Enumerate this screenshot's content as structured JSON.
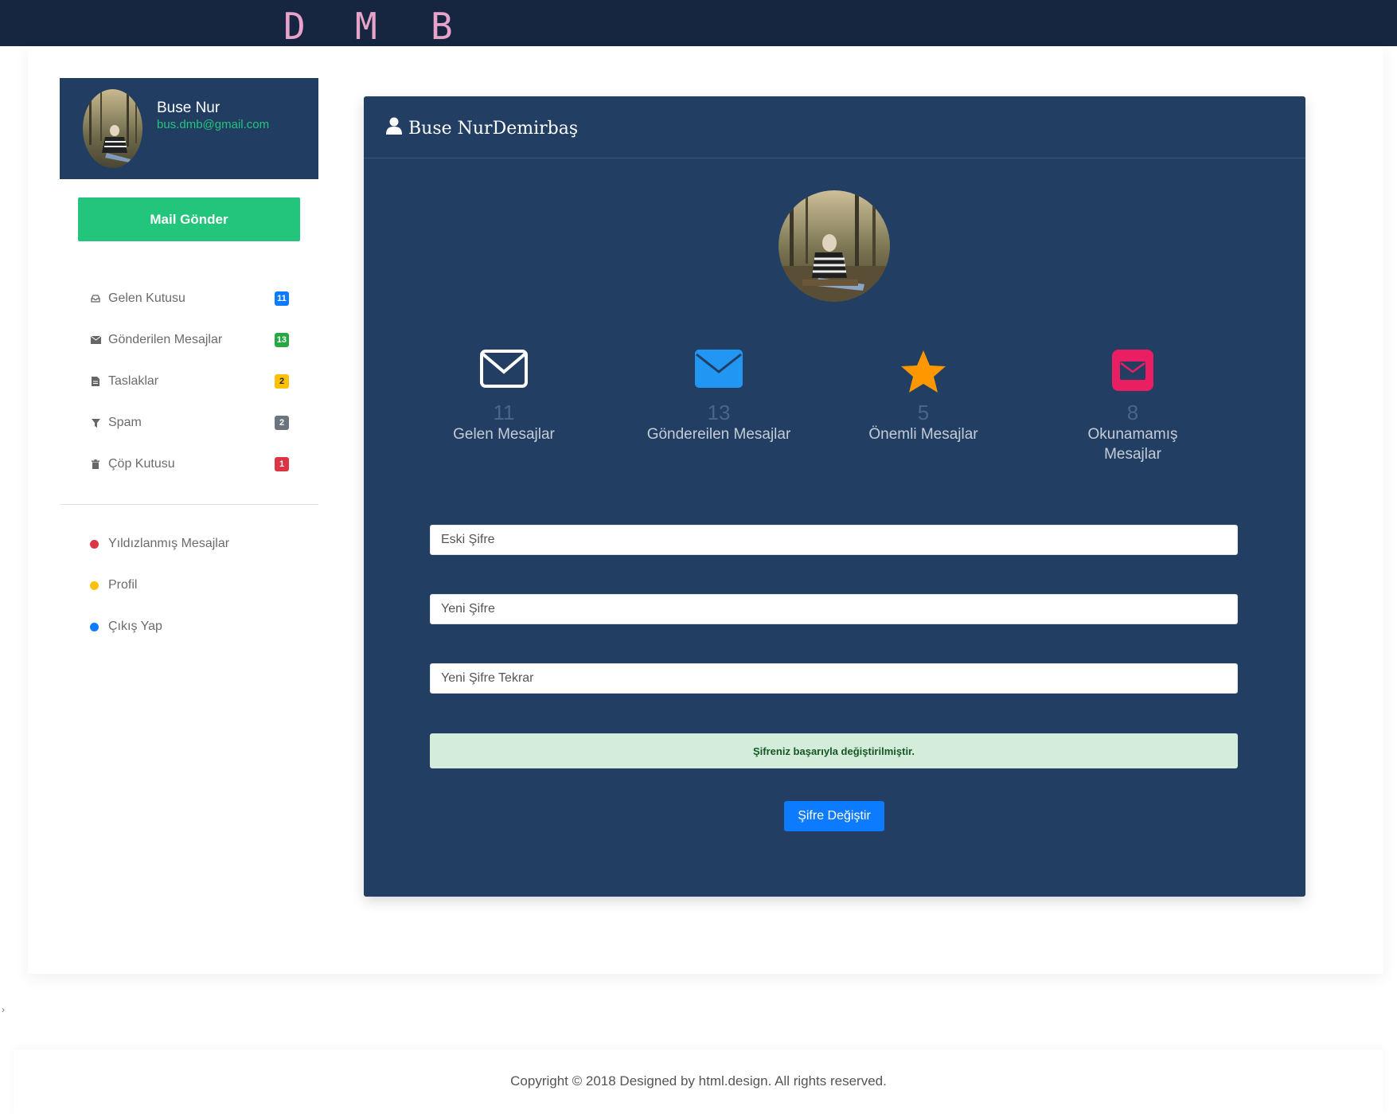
{
  "brand": {
    "letters": [
      "D",
      "M",
      "B"
    ],
    "color": "#e7a3c9"
  },
  "profile": {
    "name": "Buse Nur",
    "email": "bus.dmb@gmail.com"
  },
  "sidebar": {
    "compose_label": "Mail Gönder",
    "folders": [
      {
        "label": "Gelen Kutusu",
        "count": "11",
        "icon": "inbox-icon",
        "badge_color": "#0d7bff"
      },
      {
        "label": "Gönderilen Mesajlar",
        "count": "13",
        "icon": "envelope-icon",
        "badge_color": "#28a745"
      },
      {
        "label": "Taslaklar",
        "count": "2",
        "icon": "file-icon",
        "badge_color": "#ffc107"
      },
      {
        "label": "Spam",
        "count": "2",
        "icon": "filter-icon",
        "badge_color": "#6c757d"
      },
      {
        "label": "Çöp Kutusu",
        "count": "1",
        "icon": "trash-icon",
        "badge_color": "#dc3545"
      }
    ],
    "links": [
      {
        "label": "Yıldızlanmış Mesajlar",
        "dot_color": "#dc3545"
      },
      {
        "label": "Profil",
        "dot_color": "#ffc107"
      },
      {
        "label": "Çıkış Yap",
        "dot_color": "#0d7bff"
      }
    ]
  },
  "panel": {
    "title": "Buse NurDemirbaş",
    "stats": [
      {
        "value": "11",
        "label": "Gelen Mesajlar",
        "icon": "envelope-outline-icon"
      },
      {
        "value": "13",
        "label": "Göndereilen Mesajlar",
        "icon": "envelope-solid-icon"
      },
      {
        "value": "5",
        "label": "Önemli Mesajlar",
        "icon": "star-icon"
      },
      {
        "value": "8",
        "label": "Okunamamış Mesajlar",
        "icon": "envelope-square-icon"
      }
    ],
    "form": {
      "old_password_placeholder": "Eski Şifre",
      "new_password_placeholder": "Yeni Şifre",
      "repeat_password_placeholder": "Yeni Şifre Tekrar",
      "success_message": "Şifreniz başarıyla değiştirilmiştir.",
      "submit_label": "Şifre Değiştir"
    }
  },
  "footer": {
    "text": "Copyright © 2018 Designed by html.design. All rights reserved."
  },
  "colors": {
    "topbar": "#172640",
    "panel": "#223f63",
    "accent_green": "#22c57b",
    "primary_blue": "#0d7bff"
  }
}
